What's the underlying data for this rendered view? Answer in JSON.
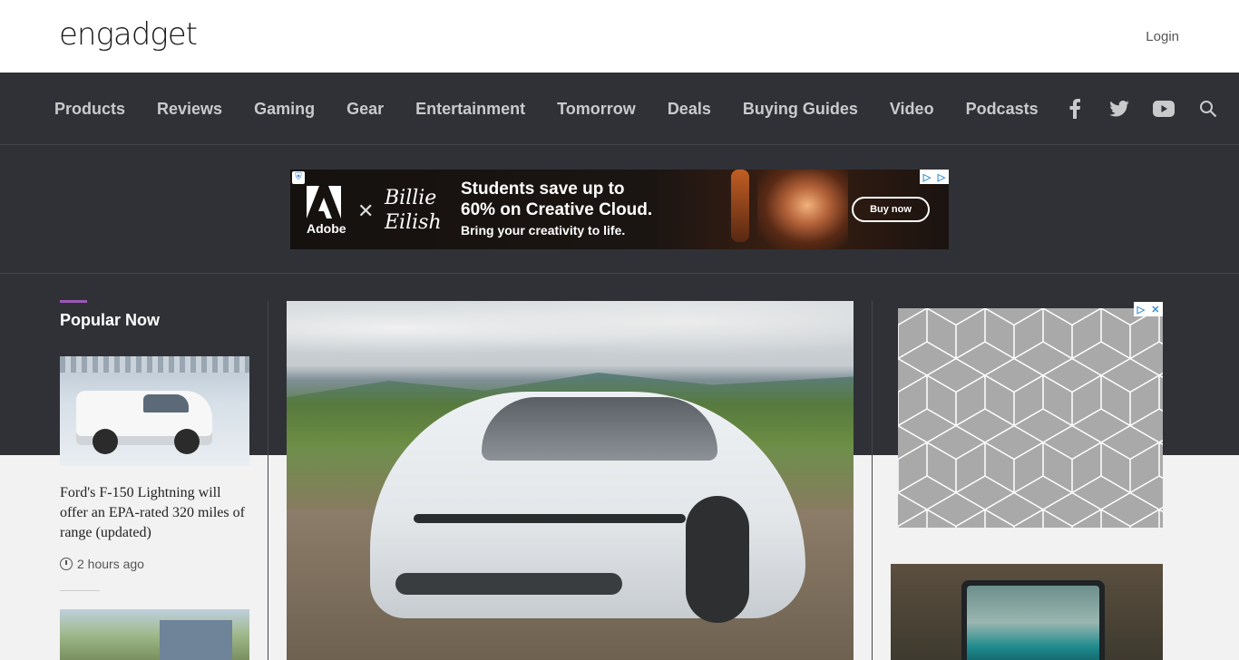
{
  "header": {
    "logo_text": "engadget",
    "login_label": "Login"
  },
  "nav": {
    "items": [
      {
        "label": "Products"
      },
      {
        "label": "Reviews"
      },
      {
        "label": "Gaming"
      },
      {
        "label": "Gear"
      },
      {
        "label": "Entertainment"
      },
      {
        "label": "Tomorrow"
      },
      {
        "label": "Deals"
      },
      {
        "label": "Buying Guides"
      },
      {
        "label": "Video"
      },
      {
        "label": "Podcasts"
      }
    ],
    "social_icons": [
      "facebook-icon",
      "twitter-icon",
      "youtube-icon",
      "search-icon"
    ]
  },
  "banner_ad": {
    "brand": "Adobe",
    "collab": "Billie Eilish",
    "headline_line1": "Students save up to",
    "headline_line2": "60% on Creative Cloud.",
    "subline": "Bring your creativity to life.",
    "cta": "Buy now"
  },
  "sidebar": {
    "section_title": "Popular Now",
    "stories": [
      {
        "headline": "Ford's F-150 Lightning will offer an EPA-rated 320 miles of range (updated)",
        "time": "2 hours ago"
      }
    ]
  },
  "colors": {
    "nav_bg": "#2f3136",
    "accent": "#9b59b6",
    "header_bg": "#ffffff"
  }
}
